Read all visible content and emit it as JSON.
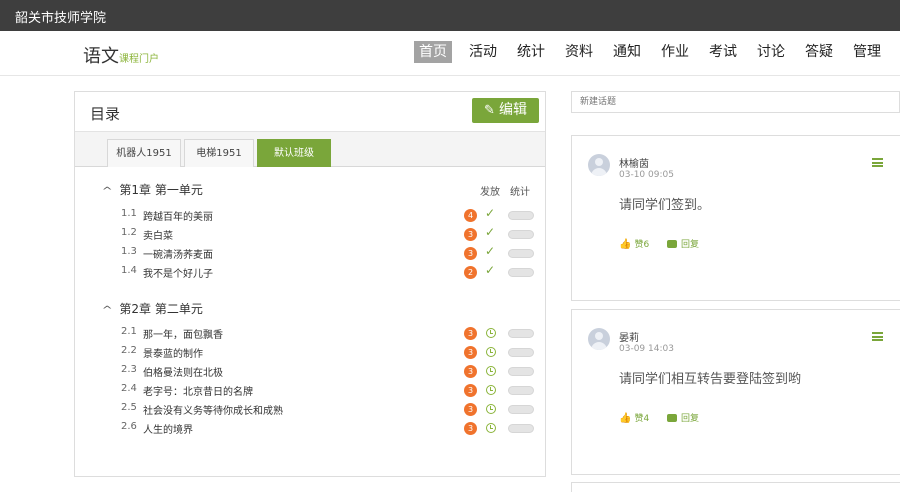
{
  "topbar": {
    "school": "韶关市技师学院"
  },
  "brand": {
    "main": "语文",
    "sub": "课程门户"
  },
  "nav": [
    {
      "label": "首页",
      "active": true
    },
    {
      "label": "活动"
    },
    {
      "label": "统计"
    },
    {
      "label": "资料"
    },
    {
      "label": "通知"
    },
    {
      "label": "作业"
    },
    {
      "label": "考试"
    },
    {
      "label": "讨论"
    },
    {
      "label": "答疑"
    },
    {
      "label": "管理"
    }
  ],
  "catalog": {
    "title": "目录",
    "edit_label": "编辑",
    "tabs": [
      "机器人1951",
      "电梯1951",
      "默认班级"
    ],
    "col_publish": "发放",
    "col_stats": "统计",
    "chapters": [
      {
        "title": "第1章 第一单元",
        "sections": [
          {
            "num": "1.1",
            "title": "跨越百年的美丽",
            "count": "4",
            "status": "check"
          },
          {
            "num": "1.2",
            "title": "卖白菜",
            "count": "3",
            "status": "check"
          },
          {
            "num": "1.3",
            "title": "一碗清汤荞麦面",
            "count": "3",
            "status": "check"
          },
          {
            "num": "1.4",
            "title": "我不是个好儿子",
            "count": "2",
            "status": "check"
          }
        ]
      },
      {
        "title": "第2章 第二单元",
        "sections": [
          {
            "num": "2.1",
            "title": "那一年，面包飘香",
            "count": "3",
            "status": "clock"
          },
          {
            "num": "2.2",
            "title": "景泰蓝的制作",
            "count": "3",
            "status": "clock"
          },
          {
            "num": "2.3",
            "title": "伯格曼法则在北极",
            "count": "3",
            "status": "clock"
          },
          {
            "num": "2.4",
            "title": "老字号：北京昔日的名牌",
            "count": "3",
            "status": "clock"
          },
          {
            "num": "2.5",
            "title": "社会没有义务等待你成长和成熟",
            "count": "3",
            "status": "clock"
          },
          {
            "num": "2.6",
            "title": "人生的境界",
            "count": "3",
            "status": "clock"
          }
        ]
      }
    ]
  },
  "discussion": {
    "new_topic_placeholder": "新建话题",
    "posts": [
      {
        "author": "林榆茵",
        "time": "03-10 09:05",
        "content": "请同学们签到。",
        "likes": "赞6",
        "reply": "回复"
      },
      {
        "author": "晏莉",
        "time": "03-09 14:03",
        "content": "请同学们相互转告要登陆签到哟",
        "likes": "赞4",
        "reply": "回复"
      }
    ]
  }
}
